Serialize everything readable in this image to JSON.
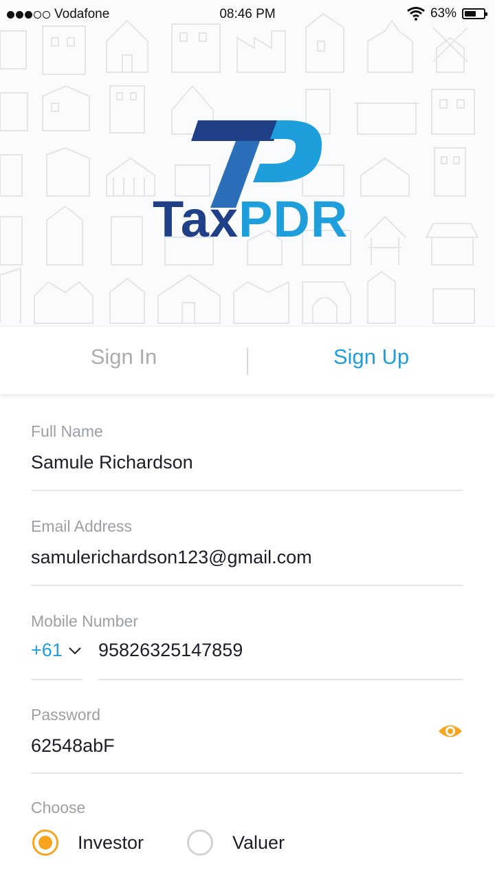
{
  "status_bar": {
    "carrier": "Vodafone",
    "time": "08:46 PM",
    "battery": "63%",
    "battery_level": 0.63,
    "signal_bars_filled": 3,
    "signal_bars_total": 5
  },
  "brand": {
    "name_part1": "Tax",
    "name_part2": "PDR",
    "colors": {
      "dark": "#1f3f86",
      "light": "#1e9fdc"
    }
  },
  "tabs": [
    {
      "label": "Sign In",
      "active": false
    },
    {
      "label": "Sign Up",
      "active": true
    }
  ],
  "form": {
    "full_name": {
      "label": "Full Name",
      "value": "Samule Richardson"
    },
    "email": {
      "label": "Email Address",
      "value": "samulerichardson123@gmail.com"
    },
    "mobile": {
      "label": "Mobile Number",
      "country_code": "+61",
      "value": "95826325147859"
    },
    "password": {
      "label": "Password",
      "value": "62548abF",
      "toggle_icon": "eye-icon"
    },
    "choose": {
      "label": "Choose",
      "options": [
        {
          "label": "Investor",
          "selected": true
        },
        {
          "label": "Valuer",
          "selected": false
        }
      ]
    }
  },
  "colors": {
    "accent": "#1e9fdc",
    "radio_selected": "#f6a51c",
    "label": "#9aa0a6"
  }
}
